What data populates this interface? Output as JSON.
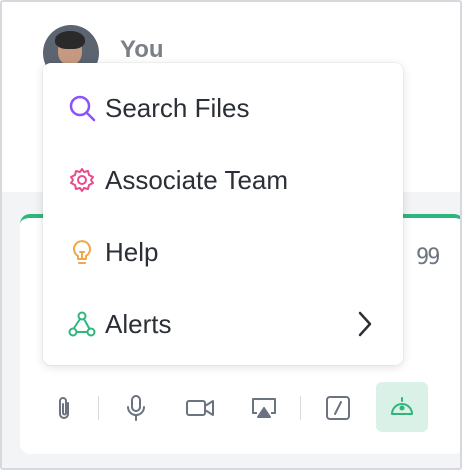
{
  "user": {
    "name": "You"
  },
  "menu": {
    "items": [
      {
        "label": "Search Files",
        "icon": "search-icon",
        "color": "#8a4fff"
      },
      {
        "label": "Associate Team",
        "icon": "gear-icon",
        "color": "#e84a8a"
      },
      {
        "label": "Help",
        "icon": "lightbulb-icon",
        "color": "#f0a64a"
      },
      {
        "label": "Alerts",
        "icon": "webhook-icon",
        "color": "#2fb67c",
        "has_submenu": true
      }
    ]
  },
  "composer": {
    "quote_glyph": "99",
    "accent_color": "#2fb67c",
    "toolbar": [
      {
        "icon": "paperclip-icon"
      },
      {
        "icon": "microphone-icon"
      },
      {
        "icon": "video-camera-icon"
      },
      {
        "icon": "screen-share-icon"
      },
      {
        "icon": "slash-command-icon"
      },
      {
        "icon": "bot-icon",
        "active": true
      }
    ]
  }
}
